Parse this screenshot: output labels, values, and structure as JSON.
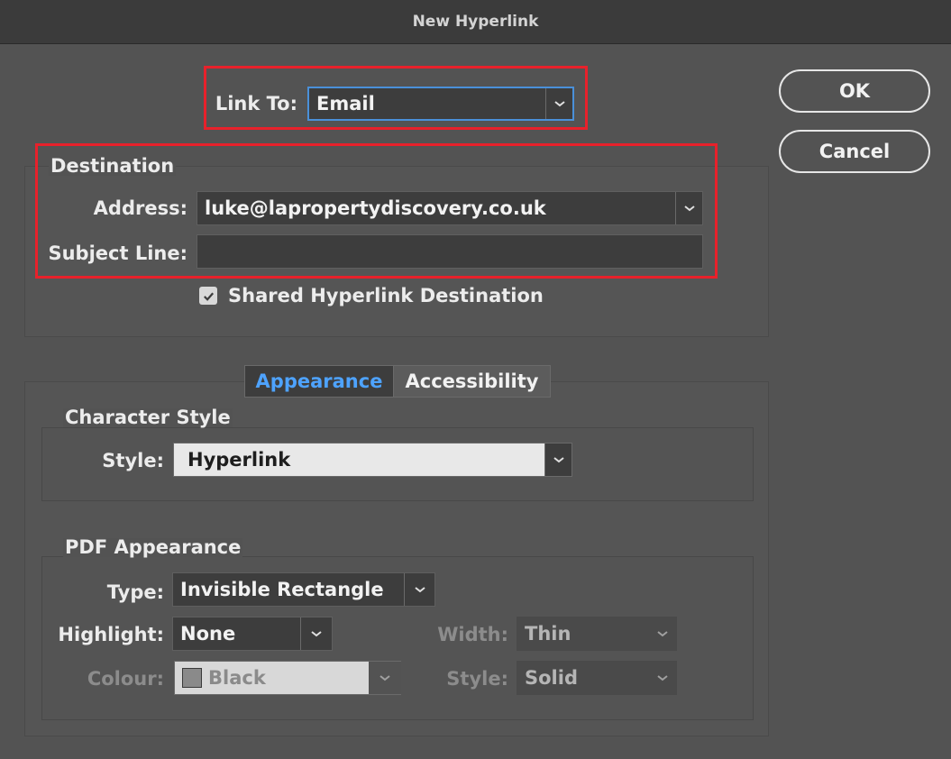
{
  "window": {
    "title": "New Hyperlink"
  },
  "link_to": {
    "label": "Link To:",
    "value": "Email"
  },
  "destination": {
    "heading": "Destination",
    "address_label": "Address:",
    "address_value": "luke@lapropertydiscovery.co.uk",
    "subject_label": "Subject Line:",
    "subject_value": "",
    "shared_label": "Shared Hyperlink Destination",
    "shared_checked": true
  },
  "buttons": {
    "ok": "OK",
    "cancel": "Cancel"
  },
  "tabs": [
    {
      "label": "Appearance",
      "active": true
    },
    {
      "label": "Accessibility",
      "active": false
    }
  ],
  "character_style": {
    "heading": "Character Style",
    "style_label": "Style:",
    "style_value": "Hyperlink"
  },
  "pdf_appearance": {
    "heading": "PDF Appearance",
    "type_label": "Type:",
    "type_value": "Invisible Rectangle",
    "highlight_label": "Highlight:",
    "highlight_value": "None",
    "width_label": "Width:",
    "width_value": "Thin",
    "colour_label": "Colour:",
    "colour_value": "Black",
    "style_label": "Style:",
    "style_value": "Solid"
  },
  "colors": {
    "accent": "#4a90d9",
    "annotation": "#e8212b",
    "active_tab_text": "#4ea3ff"
  }
}
